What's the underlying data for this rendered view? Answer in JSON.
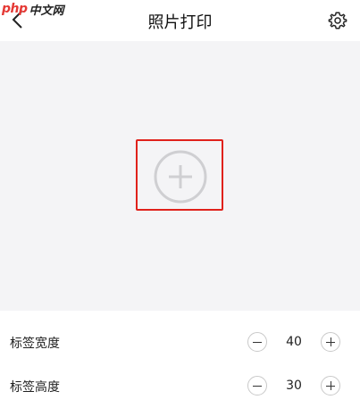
{
  "header": {
    "title": "照片打印",
    "back_icon": "chevron-left-icon",
    "settings_icon": "gear-icon"
  },
  "watermark": {
    "brand": "php",
    "text": "中文网"
  },
  "canvas": {
    "add_icon": "plus-circle-icon",
    "highlight_color": "#e0211b",
    "background_color": "#f4f4f6"
  },
  "settings": {
    "rows": [
      {
        "label": "标签宽度",
        "value": "40"
      },
      {
        "label": "标签高度",
        "value": "30"
      }
    ]
  }
}
